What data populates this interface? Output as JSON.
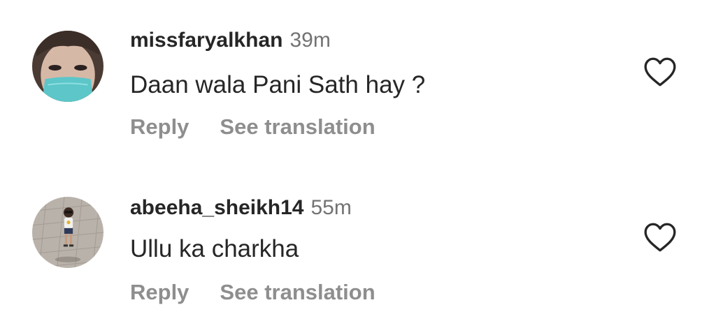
{
  "comments": [
    {
      "username": "missfaryalkhan",
      "time": "39m",
      "text": "Daan wala Pani Sath hay ?",
      "reply_label": "Reply",
      "translate_label": "See translation",
      "avatar_icon": "avatar-woman-mask",
      "like_icon": "heart-outline-icon"
    },
    {
      "username": "abeeha_sheikh14",
      "time": "55m",
      "text": "Ullu ka charkha",
      "reply_label": "Reply",
      "translate_label": "See translation",
      "avatar_icon": "avatar-child-on-pavement",
      "like_icon": "heart-outline-icon"
    }
  ],
  "colors": {
    "text_primary": "#262626",
    "text_secondary": "#737373",
    "action_text": "#8e8e8e",
    "mask_teal": "#5cc6c9",
    "background": "#ffffff"
  }
}
